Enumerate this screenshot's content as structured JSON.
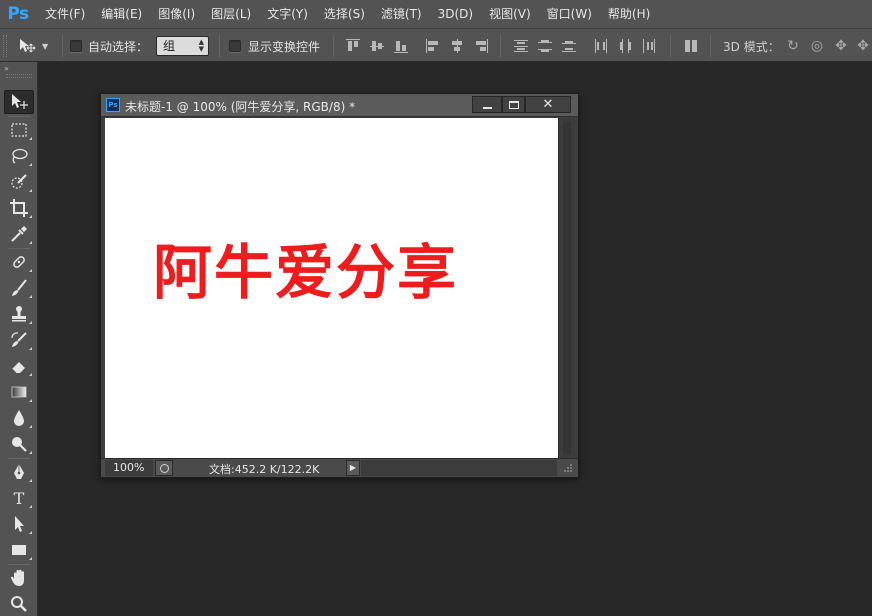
{
  "app": {
    "logo": "Ps",
    "logo_color": "#31a8ff"
  },
  "menu": [
    {
      "id": "file",
      "label": "文件(F)"
    },
    {
      "id": "edit",
      "label": "编辑(E)"
    },
    {
      "id": "image",
      "label": "图像(I)"
    },
    {
      "id": "layer",
      "label": "图层(L)"
    },
    {
      "id": "type",
      "label": "文字(Y)"
    },
    {
      "id": "select",
      "label": "选择(S)"
    },
    {
      "id": "filter",
      "label": "滤镜(T)"
    },
    {
      "id": "3d",
      "label": "3D(D)"
    },
    {
      "id": "view",
      "label": "视图(V)"
    },
    {
      "id": "window",
      "label": "窗口(W)"
    },
    {
      "id": "help",
      "label": "帮助(H)"
    }
  ],
  "options": {
    "tool_preset_icon": "move-tool-icon",
    "auto_select_label": "自动选择：",
    "auto_select_checked": false,
    "auto_select_value": "组",
    "show_transform_label": "显示变换控件",
    "show_transform_checked": false,
    "mode_3d_label": "3D 模式："
  },
  "toolbox": {
    "collapse_glyph": "»",
    "tools": [
      {
        "id": "move",
        "icon": "move-tool-icon",
        "active": true
      },
      {
        "id": "marquee",
        "icon": "rectangular-marquee-icon"
      },
      {
        "id": "lasso",
        "icon": "lasso-icon"
      },
      {
        "id": "quick-select",
        "icon": "quick-selection-icon"
      },
      {
        "id": "crop",
        "icon": "crop-icon"
      },
      {
        "id": "eyedropper",
        "icon": "eyedropper-icon"
      },
      {
        "id": "healing",
        "icon": "spot-healing-brush-icon"
      },
      {
        "id": "brush",
        "icon": "brush-icon"
      },
      {
        "id": "stamp",
        "icon": "clone-stamp-icon"
      },
      {
        "id": "history-brush",
        "icon": "history-brush-icon"
      },
      {
        "id": "eraser",
        "icon": "eraser-icon"
      },
      {
        "id": "gradient",
        "icon": "gradient-icon"
      },
      {
        "id": "blur",
        "icon": "blur-icon"
      },
      {
        "id": "dodge",
        "icon": "dodge-icon"
      },
      {
        "id": "pen",
        "icon": "pen-icon"
      },
      {
        "id": "type",
        "icon": "type-tool-icon",
        "label": "T"
      },
      {
        "id": "path-select",
        "icon": "path-selection-icon"
      },
      {
        "id": "shape",
        "icon": "rectangle-shape-icon"
      },
      {
        "id": "hand",
        "icon": "hand-icon"
      },
      {
        "id": "zoom",
        "icon": "zoom-icon"
      }
    ]
  },
  "document": {
    "title": "未标题-1 @ 100% (阿牛爱分享, RGB/8) *",
    "icon_label": "Ps",
    "canvas_text": "阿牛爱分享",
    "canvas_text_color": "#ee1c1c",
    "canvas_bg": "#ffffff",
    "zoom": "100%",
    "doc_info": "文档:452.2 K/122.2K"
  }
}
